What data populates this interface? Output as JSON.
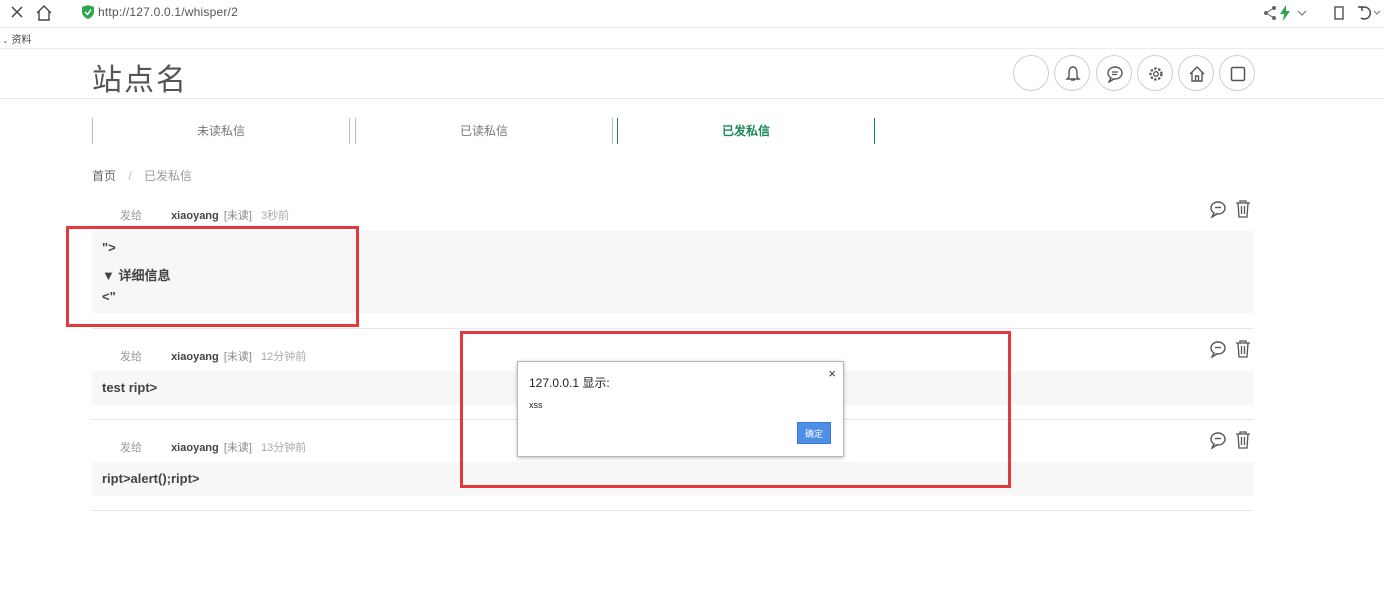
{
  "browser": {
    "url": "http://127.0.0.1/whisper/2",
    "bookmark_label": "资料"
  },
  "site": {
    "title": "站点名",
    "header_icons": [
      "blank-circle",
      "bell-icon",
      "chat-icon",
      "gear-icon",
      "home-icon",
      "square-icon"
    ]
  },
  "tabs": [
    {
      "label": "未读私信",
      "active": false
    },
    {
      "label": "已读私信",
      "active": false
    },
    {
      "label": "已发私信",
      "active": true
    }
  ],
  "breadcrumb": {
    "home": "首页",
    "separator": "/",
    "current": "已发私信"
  },
  "messages": [
    {
      "prefix": "发给",
      "user": "xiaoyang",
      "status": "[未读]",
      "time": "3秒前",
      "lines": [
        "\">",
        "▼ 详细信息",
        "<\""
      ]
    },
    {
      "prefix": "发给",
      "user": "xiaoyang",
      "status": "[未读]",
      "time": "12分钟前",
      "lines": [
        "test ript>"
      ]
    },
    {
      "prefix": "发给",
      "user": "xiaoyang",
      "status": "[未读]",
      "time": "13分钟前",
      "lines": [
        "ript>alert();ript>"
      ]
    }
  ],
  "dialog": {
    "title": "127.0.0.1 显示:",
    "message": "xss",
    "ok_label": "确定",
    "close_glyph": "×"
  },
  "colors": {
    "accent": "#1a8a5a",
    "annotation": "#e4383c",
    "dialog_button": "#4d8ee8"
  }
}
